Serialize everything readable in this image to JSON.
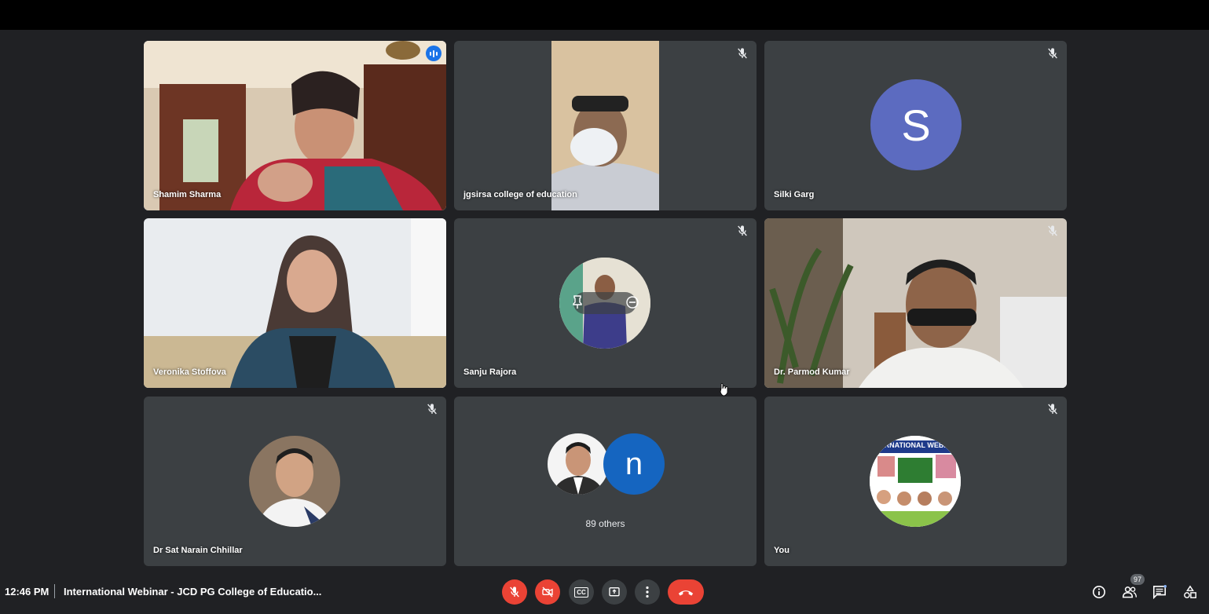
{
  "meeting": {
    "time": "12:46 PM",
    "title": "International Webinar - JCD PG College of Educatio..."
  },
  "participants": [
    {
      "name": "Shamim Sharma",
      "state": "speaking"
    },
    {
      "name": "jgsirsa college of education",
      "state": "muted"
    },
    {
      "name": "Silki Garg",
      "state": "muted",
      "initial": "S",
      "avatar_color": "#5c6bc0"
    },
    {
      "name": "Veronika Stoffova",
      "state": "video"
    },
    {
      "name": "Sanju Rajora",
      "state": "muted"
    },
    {
      "name": "Dr. Parmod Kumar",
      "state": "muted"
    },
    {
      "name": "Dr Sat Narain Chhillar",
      "state": "muted"
    },
    {
      "name": "You",
      "state": "muted"
    }
  ],
  "others": {
    "label": "89 others",
    "initial": "n",
    "avatar_color": "#1565c0"
  },
  "webinar_banner_text": "ERNATIONAL WEBIN",
  "controls": {
    "mic": "mic-off-icon",
    "camera": "videocam-off-icon",
    "captions_label": "CC",
    "present": "present-icon",
    "more": "more-vert-icon",
    "hangup": "call-end-icon"
  },
  "participant_count": "97",
  "colors": {
    "background": "#202124",
    "tile": "#3c4043",
    "accent": "#8ab4f8",
    "danger": "#ea4335"
  }
}
